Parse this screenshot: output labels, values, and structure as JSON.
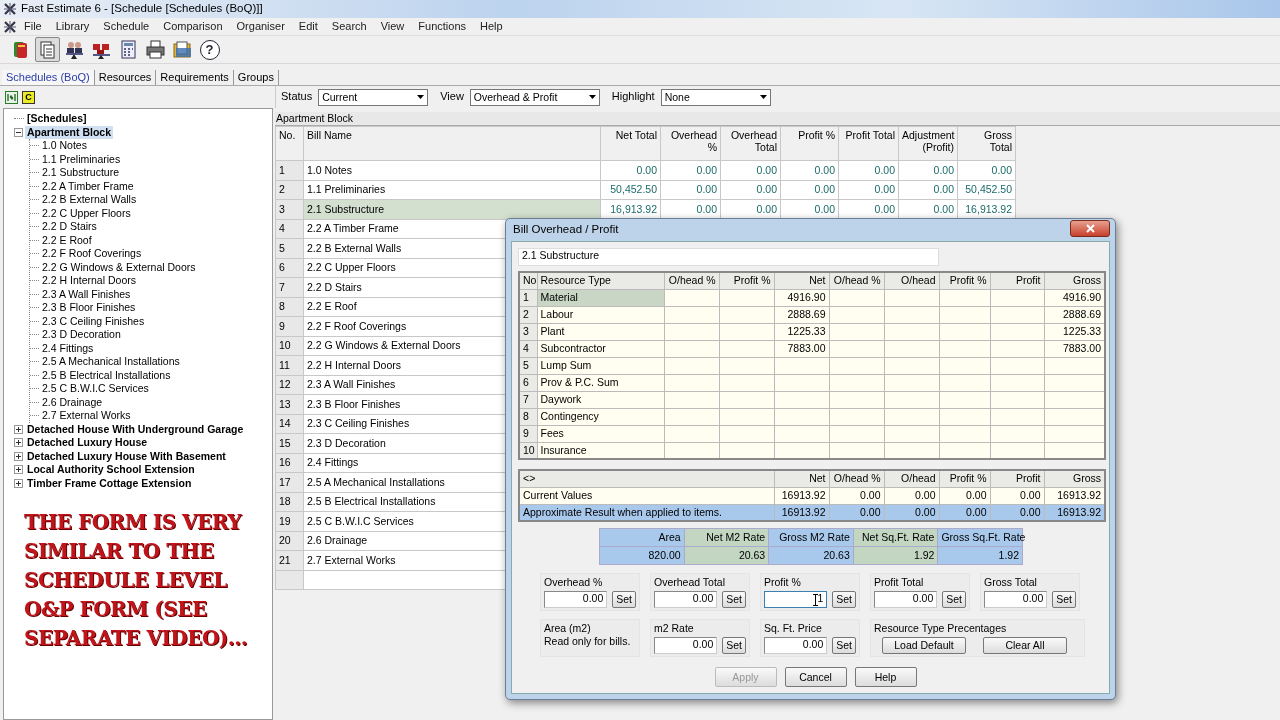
{
  "window": {
    "title": "Fast Estimate 6 - [Schedule [Schedules (BoQ)]]"
  },
  "menu": [
    "File",
    "Library",
    "Schedule",
    "Comparison",
    "Organiser",
    "Edit",
    "Search",
    "View",
    "Functions",
    "Help"
  ],
  "toolbar": [
    {
      "kind": "book",
      "pressed": false
    },
    {
      "kind": "pages",
      "pressed": true
    },
    {
      "kind": "people",
      "pressed": false
    },
    {
      "kind": "blocks",
      "pressed": false
    },
    {
      "kind": "calculator",
      "pressed": false
    },
    {
      "kind": "printer",
      "pressed": false
    },
    {
      "kind": "folder",
      "pressed": false
    },
    {
      "kind": "help",
      "pressed": false,
      "glyph": "?"
    }
  ],
  "tabs": [
    {
      "label": "Schedules (BoQ)",
      "selected": true
    },
    {
      "label": "Resources",
      "selected": false
    },
    {
      "label": "Requirements",
      "selected": false
    },
    {
      "label": "Groups",
      "selected": false
    }
  ],
  "tree_toolbar": [
    {
      "kind": "arrows"
    },
    {
      "kind": "letter",
      "glyph": "C"
    }
  ],
  "tree": [
    {
      "kind": "heading",
      "label": "[Schedules]",
      "selected": false
    },
    {
      "kind": "folder",
      "label": "Apartment Block",
      "selected": true,
      "expanded": true,
      "children": [
        {
          "label": "1.0 Notes",
          "selected": false
        },
        {
          "label": "1.1 Preliminaries",
          "selected": false
        },
        {
          "label": "2.1 Substructure",
          "selected": false
        },
        {
          "label": "2.2 A Timber Frame",
          "selected": false
        },
        {
          "label": "2.2 B External Walls",
          "selected": false
        },
        {
          "label": "2.2 C Upper Floors",
          "selected": false
        },
        {
          "label": "2.2 D Stairs",
          "selected": false
        },
        {
          "label": "2.2 E Roof",
          "selected": false
        },
        {
          "label": "2.2 F Roof Coverings",
          "selected": false
        },
        {
          "label": "2.2 G Windows & External Doors",
          "selected": false
        },
        {
          "label": "2.2 H Internal Doors",
          "selected": false
        },
        {
          "label": "2.3 A Wall Finishes",
          "selected": false
        },
        {
          "label": "2.3 B Floor Finishes",
          "selected": false
        },
        {
          "label": "2.3 C Ceiling Finishes",
          "selected": false
        },
        {
          "label": "2.3 D Decoration",
          "selected": false
        },
        {
          "label": "2.4 Fittings",
          "selected": false
        },
        {
          "label": "2.5 A Mechanical Installations",
          "selected": false
        },
        {
          "label": "2.5 B Electrical Installations",
          "selected": false
        },
        {
          "label": "2.5 C B.W.I.C Services",
          "selected": false
        },
        {
          "label": "2.6 Drainage",
          "selected": false
        },
        {
          "label": "2.7 External Works",
          "selected": false
        }
      ]
    },
    {
      "kind": "folder",
      "label": "Detached House With Underground Garage",
      "selected": false,
      "expanded": false
    },
    {
      "kind": "folder",
      "label": "Detached Luxury House",
      "selected": false,
      "expanded": false
    },
    {
      "kind": "folder",
      "label": "Detached Luxury House With Basement",
      "selected": false,
      "expanded": false
    },
    {
      "kind": "folder",
      "label": "Local Authority School Extension",
      "selected": false,
      "expanded": false
    },
    {
      "kind": "folder",
      "label": "Timber Frame Cottage Extension",
      "selected": false,
      "expanded": false
    }
  ],
  "annotation": {
    "lines": [
      "THE FORM IS VERY",
      "SIMILAR TO THE",
      "SCHEDULE LEVEL",
      "O&P FORM (SEE",
      "SEPARATE VIDEO)..."
    ]
  },
  "filters": [
    {
      "label": "Status",
      "value": "Current"
    },
    {
      "label": "View",
      "value": "Overhead & Profit"
    },
    {
      "label": "Highlight",
      "value": "None"
    }
  ],
  "grid": {
    "caption": "Apartment Block",
    "columns": [
      "No.",
      "Bill Name",
      "Net Total",
      "Overhead %",
      "Overhead Total",
      "Profit %",
      "Profit Total",
      "Adjustment (Profit)",
      "Gross Total"
    ],
    "rows": [
      {
        "no": "1",
        "name": "1.0 Notes",
        "selected": false,
        "values": [
          "0.00",
          "0.00",
          "0.00",
          "0.00",
          "0.00",
          "0.00",
          "0.00"
        ]
      },
      {
        "no": "2",
        "name": "1.1 Preliminaries",
        "selected": false,
        "values": [
          "50,452.50",
          "0.00",
          "0.00",
          "0.00",
          "0.00",
          "0.00",
          "50,452.50"
        ]
      },
      {
        "no": "3",
        "name": "2.1 Substructure",
        "selected": true,
        "values": [
          "16,913.92",
          "0.00",
          "0.00",
          "0.00",
          "0.00",
          "0.00",
          "16,913.92"
        ]
      },
      {
        "no": "4",
        "name": "2.2 A Timber Frame",
        "selected": false
      },
      {
        "no": "5",
        "name": "2.2 B External Walls",
        "selected": false
      },
      {
        "no": "6",
        "name": "2.2 C Upper Floors",
        "selected": false
      },
      {
        "no": "7",
        "name": "2.2 D Stairs",
        "selected": false
      },
      {
        "no": "8",
        "name": "2.2 E Roof",
        "selected": false
      },
      {
        "no": "9",
        "name": "2.2 F Roof Coverings",
        "selected": false
      },
      {
        "no": "10",
        "name": "2.2 G Windows & External Doors",
        "selected": false
      },
      {
        "no": "11",
        "name": "2.2 H Internal Doors",
        "selected": false
      },
      {
        "no": "12",
        "name": "2.3 A Wall Finishes",
        "selected": false
      },
      {
        "no": "13",
        "name": "2.3 B Floor Finishes",
        "selected": false
      },
      {
        "no": "14",
        "name": "2.3 C Ceiling Finishes",
        "selected": false
      },
      {
        "no": "15",
        "name": "2.3 D Decoration",
        "selected": false
      },
      {
        "no": "16",
        "name": "2.4 Fittings",
        "selected": false
      },
      {
        "no": "17",
        "name": "2.5 A Mechanical Installations",
        "selected": false
      },
      {
        "no": "18",
        "name": "2.5 B Electrical Installations",
        "selected": false
      },
      {
        "no": "19",
        "name": "2.5 C B.W.I.C Services",
        "selected": false
      },
      {
        "no": "20",
        "name": "2.6 Drainage",
        "selected": false
      },
      {
        "no": "21",
        "name": "2.7 External Works",
        "selected": false
      }
    ]
  },
  "dialog": {
    "title": "Bill Overhead / Profit",
    "bill_name": "2.1 Substructure",
    "resource_columns": [
      "No",
      "Resource Type",
      "O/head %",
      "Profit %",
      "Net",
      "O/head %",
      "O/head",
      "Profit %",
      "Profit",
      "Gross"
    ],
    "resources": [
      {
        "no": "1",
        "type": "Material",
        "net": "4916.90",
        "gross": "4916.90",
        "selected": true
      },
      {
        "no": "2",
        "type": "Labour",
        "net": "2888.69",
        "gross": "2888.69",
        "selected": false
      },
      {
        "no": "3",
        "type": "Plant",
        "net": "1225.33",
        "gross": "1225.33",
        "selected": false
      },
      {
        "no": "4",
        "type": "Subcontractor",
        "net": "7883.00",
        "gross": "7883.00",
        "selected": false
      },
      {
        "no": "5",
        "type": "Lump Sum",
        "selected": false
      },
      {
        "no": "6",
        "type": "Prov & P.C. Sum",
        "selected": false
      },
      {
        "no": "7",
        "type": "Daywork",
        "selected": false
      },
      {
        "no": "8",
        "type": "Contingency",
        "selected": false
      },
      {
        "no": "9",
        "type": "Fees",
        "selected": false
      },
      {
        "no": "10",
        "type": "Insurance",
        "selected": false
      }
    ],
    "summary_columns": [
      "<>",
      "Net",
      "O/head %",
      "O/head",
      "Profit %",
      "Profit",
      "Gross"
    ],
    "summary_rows": [
      {
        "label": "Current Values",
        "selected": false,
        "values": [
          "16913.92",
          "0.00",
          "0.00",
          "0.00",
          "0.00",
          "16913.92"
        ]
      },
      {
        "label": "Approximate Result when applied to items.",
        "selected": true,
        "values": [
          "16913.92",
          "0.00",
          "0.00",
          "0.00",
          "0.00",
          "16913.92"
        ]
      }
    ],
    "rates": {
      "columns": [
        "Area",
        "Net M2 Rate",
        "Gross M2 Rate",
        "Net Sq.Ft. Rate",
        "Gross Sq.Ft. Rate"
      ],
      "values": [
        "820.00",
        "20.63",
        "20.63",
        "1.92",
        "1.92"
      ]
    },
    "field_rows": [
      [
        {
          "kind": "field",
          "label": "Overhead %",
          "value": "0.00",
          "button": "Set",
          "focused": false
        },
        {
          "kind": "field",
          "label": "Overhead Total",
          "value": "0.00",
          "button": "Set",
          "focused": false
        },
        {
          "kind": "field",
          "label": "Profit %",
          "value": "1",
          "button": "Set",
          "focused": true
        },
        {
          "kind": "field",
          "label": "Profit Total",
          "value": "0.00",
          "button": "Set",
          "focused": false
        },
        {
          "kind": "field",
          "label": "Gross Total",
          "value": "0.00",
          "button": "Set",
          "focused": false
        }
      ],
      [
        {
          "kind": "note",
          "label": "Area (m2)",
          "text": "Read only for bills."
        },
        {
          "kind": "field",
          "label": "m2 Rate",
          "value": "0.00",
          "button": "Set",
          "focused": false
        },
        {
          "kind": "field",
          "label": "Sq. Ft. Price",
          "value": "0.00",
          "button": "Set",
          "focused": false
        },
        {
          "kind": "buttons",
          "label": "Resource Type Precentages",
          "buttons": [
            "Load Default",
            "Clear All"
          ]
        }
      ]
    ],
    "buttons": [
      {
        "label": "Apply",
        "disabled": true
      },
      {
        "label": "Cancel",
        "disabled": false
      },
      {
        "label": "Help",
        "disabled": false
      }
    ]
  }
}
